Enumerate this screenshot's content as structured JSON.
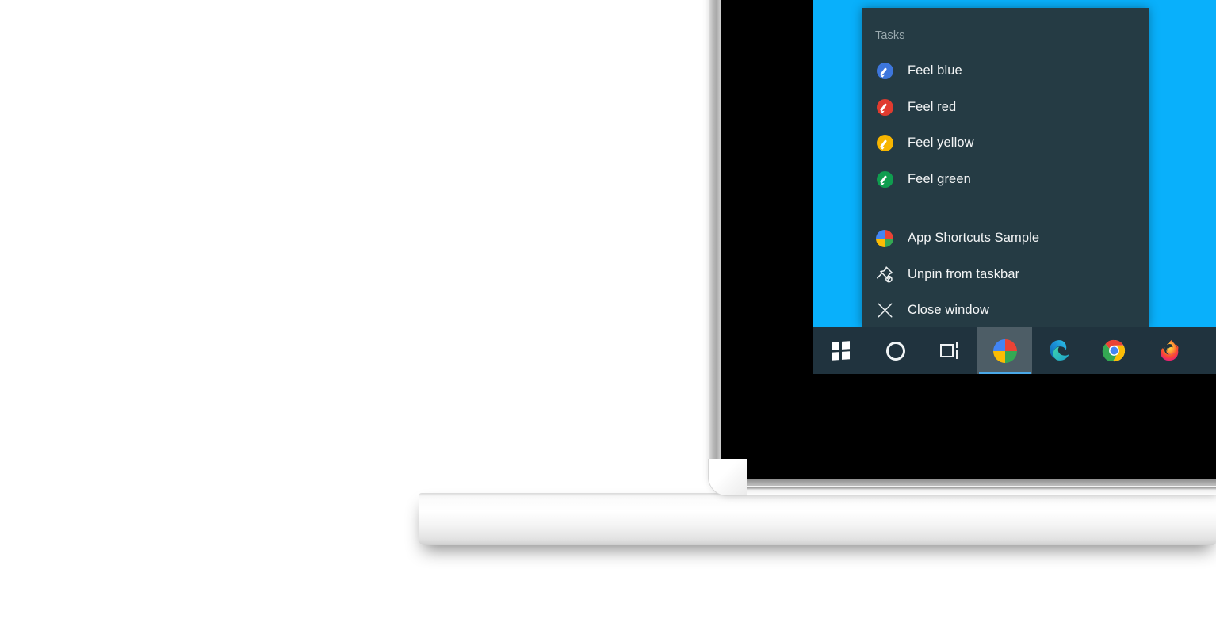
{
  "scene": {
    "device": "laptop",
    "desktop_background_color": "#09b0fb",
    "screen_black_bezel_color": "#000000",
    "laptop_body_color": "#ededed"
  },
  "jump_list": {
    "panel_color": "#253b44",
    "header_label": "Tasks",
    "tasks": [
      {
        "label": "Feel blue",
        "icon": "brush-dot-blue-icon",
        "color": "#3d76dc"
      },
      {
        "label": "Feel red",
        "icon": "brush-dot-red-icon",
        "color": "#e03b2f"
      },
      {
        "label": "Feel yellow",
        "icon": "brush-dot-yellow-icon",
        "color": "#f7b500"
      },
      {
        "label": "Feel green",
        "icon": "brush-dot-green-icon",
        "color": "#0f9d4f"
      }
    ],
    "actions": [
      {
        "label": "App Shortcuts Sample",
        "icon": "app-quad-icon"
      },
      {
        "label": "Unpin from taskbar",
        "icon": "unpin-icon"
      },
      {
        "label": "Close window",
        "icon": "close-x-icon"
      }
    ]
  },
  "taskbar": {
    "background_color": "#20333e",
    "active_highlight_color": "#4d5d66",
    "active_underline_color": "#4aa8e8",
    "buttons": [
      {
        "name": "start-button",
        "icon": "windows-start-icon",
        "label": "Start",
        "active": false
      },
      {
        "name": "cortana-button",
        "icon": "cortana-circle-icon",
        "label": "Cortana",
        "active": false
      },
      {
        "name": "task-view-button",
        "icon": "task-view-icon",
        "label": "Task View",
        "active": false
      },
      {
        "name": "app-shortcuts-app",
        "icon": "app-quad-icon",
        "label": "App Shortcuts Sample",
        "active": true
      },
      {
        "name": "edge-button",
        "icon": "edge-icon",
        "label": "Microsoft Edge",
        "active": false
      },
      {
        "name": "chrome-button",
        "icon": "chrome-icon",
        "label": "Google Chrome",
        "active": false
      },
      {
        "name": "firefox-button",
        "icon": "firefox-icon",
        "label": "Mozilla Firefox",
        "active": false
      }
    ]
  },
  "app_icon_quadrants": {
    "top_left": "#4285f4",
    "top_right": "#ea4335",
    "bottom_left": "#fbbc04",
    "bottom_right": "#34a853"
  }
}
